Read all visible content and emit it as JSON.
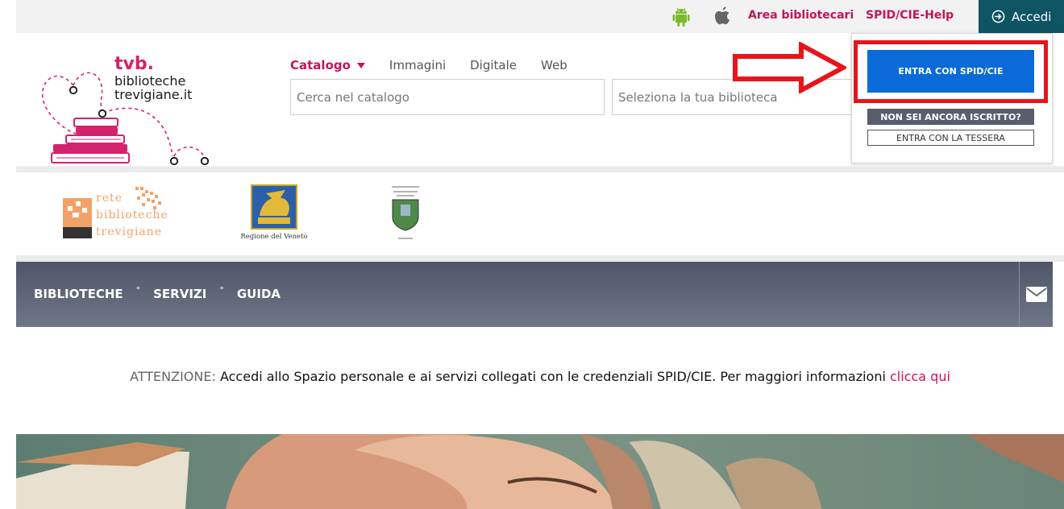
{
  "topbar": {
    "android_icon": "android-icon",
    "apple_icon": "apple-icon",
    "area_bibliotecari": "Area bibliotecari",
    "spid_help": "SPID/CIE-Help",
    "accedi": "Accedi"
  },
  "logo": {
    "line1": "tvb.",
    "line2": "biblioteche",
    "line3": "trevigiane.it"
  },
  "search": {
    "tabs": [
      {
        "label": "Catalogo"
      },
      {
        "label": "Immagini"
      },
      {
        "label": "Digitale"
      },
      {
        "label": "Web"
      }
    ],
    "placeholder": "Cerca nel catalogo",
    "library_select": "Seleziona la tua biblioteca"
  },
  "login_menu": {
    "spid_button": "ENTRA CON SPID/CIE",
    "not_registered": "NON SEI ANCORA ISCRITTO?",
    "card_button": "ENTRA CON LA TESSERA"
  },
  "partners": {
    "rete_line1": "rete",
    "rete_line2": "biblioteche",
    "rete_line3": "trevigiane",
    "veneto_caption": "Regione del Veneto"
  },
  "mainnav": {
    "items": [
      "BIBLIOTECHE",
      "SERVIZI",
      "GUIDA"
    ],
    "separator": "°"
  },
  "notice": {
    "label": "ATTENZIONE:",
    "text": " Accedi allo Spazio personale e ai servizi collegati con le credenziali SPID/CIE. Per maggiori informazioni ",
    "link": "clicca qui"
  },
  "colors": {
    "brand": "#c4145a",
    "accedi_bg": "#0e5463",
    "spid_blue": "#0a6bd8",
    "highlight_red": "#e8141c",
    "nav_bg": "#5a6172"
  }
}
